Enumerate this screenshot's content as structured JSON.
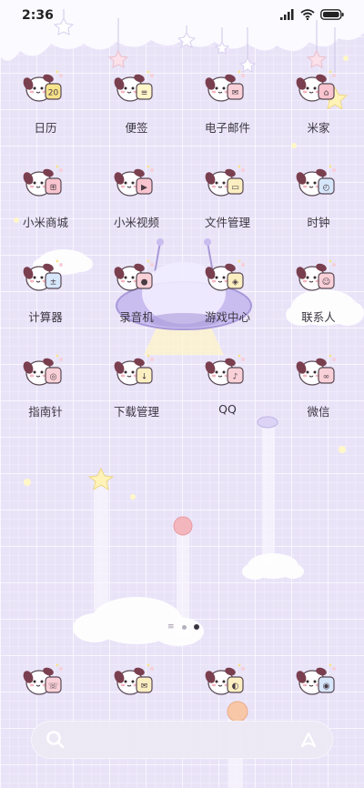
{
  "status_bar": {
    "time": "2:36"
  },
  "apps": [
    {
      "label": "日历",
      "glyph": "20",
      "badge_color": "#f7e38a"
    },
    {
      "label": "便签",
      "glyph": "≡",
      "badge_color": "#fff6c9"
    },
    {
      "label": "电子邮件",
      "glyph": "✉",
      "badge_color": "#f9d0d7"
    },
    {
      "label": "米家",
      "glyph": "⌂",
      "badge_color": "#f9c4cf"
    },
    {
      "label": "小米商城",
      "glyph": "⊞",
      "badge_color": "#f9c4cf"
    },
    {
      "label": "小米视频",
      "glyph": "▶",
      "badge_color": "#f9c4cf"
    },
    {
      "label": "文件管理",
      "glyph": "▭",
      "badge_color": "#fbeec0"
    },
    {
      "label": "时钟",
      "glyph": "◴",
      "badge_color": "#d6e6fb"
    },
    {
      "label": "计算器",
      "glyph": "±",
      "badge_color": "#d6e6fb"
    },
    {
      "label": "录音机",
      "glyph": "●",
      "badge_color": "#f9d0d7"
    },
    {
      "label": "游戏中心",
      "glyph": "◈",
      "badge_color": "#fbeec0"
    },
    {
      "label": "联系人",
      "glyph": "☺",
      "badge_color": "#f9d0d7"
    },
    {
      "label": "指南针",
      "glyph": "◎",
      "badge_color": "#f9d0d7"
    },
    {
      "label": "下载管理",
      "glyph": "↓",
      "badge_color": "#fbeec0"
    },
    {
      "label": "QQ",
      "glyph": "♪",
      "badge_color": "#f9d0d7"
    },
    {
      "label": "微信",
      "glyph": "∞",
      "badge_color": "#f9d0d7"
    }
  ],
  "dock": [
    {
      "name": "phone",
      "glyph": "☏",
      "badge_color": "#f9d0d7"
    },
    {
      "name": "messages",
      "glyph": "✉",
      "badge_color": "#fbeec0"
    },
    {
      "name": "browser",
      "glyph": "◐",
      "badge_color": "#fbeec0"
    },
    {
      "name": "camera",
      "glyph": "◉",
      "badge_color": "#d6e6fb"
    }
  ],
  "page_indicator": {
    "pages": 2,
    "active": 2
  },
  "search_bar": {
    "left_icon": "search-icon",
    "right_icon": "assistant-icon"
  }
}
